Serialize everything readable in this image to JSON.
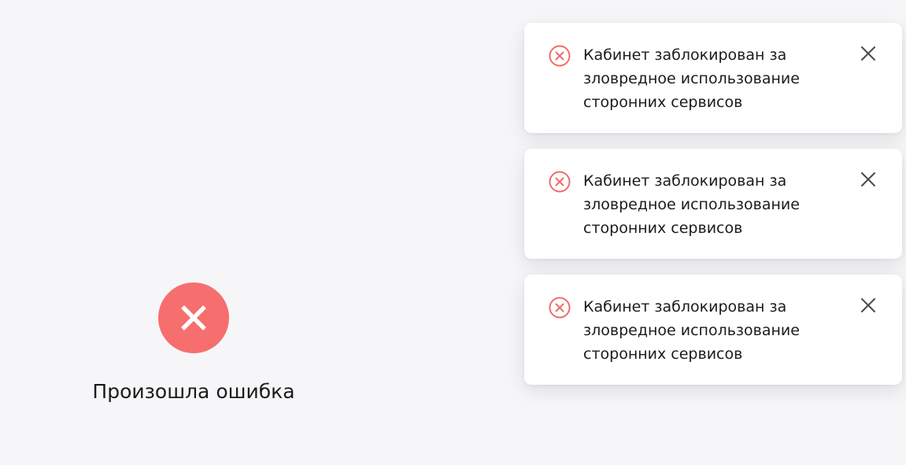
{
  "error_state": {
    "icon": "error-x-icon",
    "title": "Произошла ошибка"
  },
  "toasts": [
    {
      "icon": "error-circle-icon",
      "message": "Кабинет заблокирован за зловредное использование сторонних сервисов",
      "close_icon": "close-icon"
    },
    {
      "icon": "error-circle-icon",
      "message": "Кабинет заблокирован за зловредное использование сторонних сервисов",
      "close_icon": "close-icon"
    },
    {
      "icon": "error-circle-icon",
      "message": "Кабинет заблокирован за зловредное использование сторонних сервисов",
      "close_icon": "close-icon"
    }
  ],
  "colors": {
    "background": "#f6f6f8",
    "error_accent": "#f76e6e",
    "text": "#1b1b1b",
    "close": "#4a4a4a"
  }
}
